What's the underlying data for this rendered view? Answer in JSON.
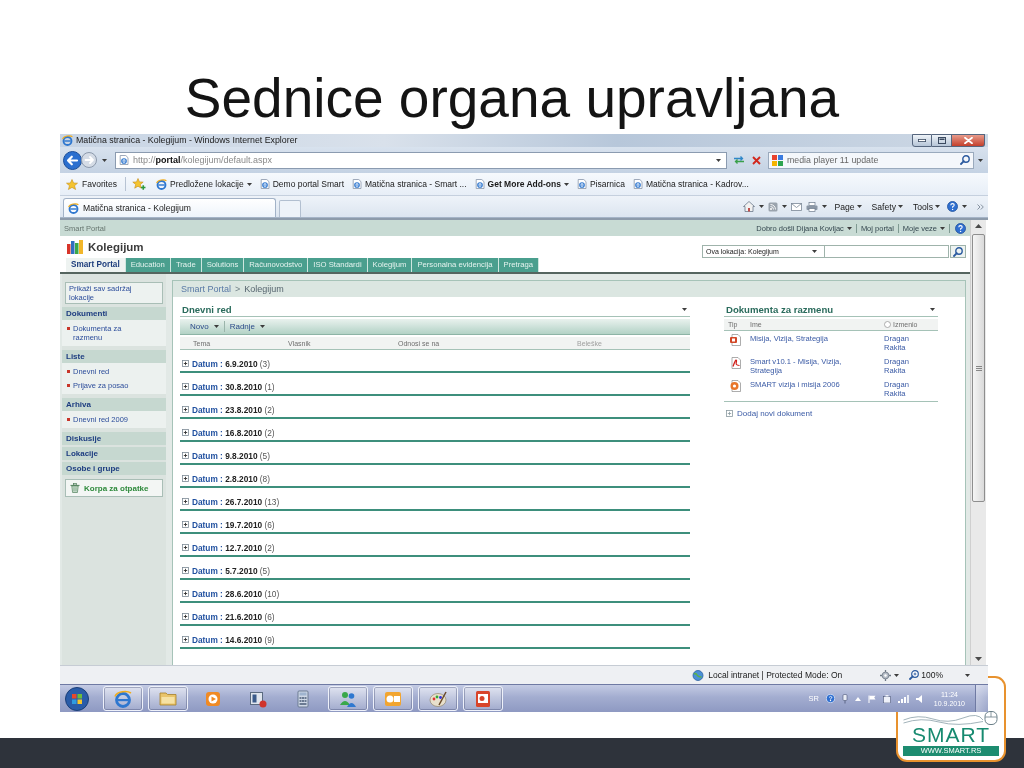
{
  "slide": {
    "title": "Sednice organa upravljana",
    "logo": {
      "wordmark": "SMART",
      "website": "WWW.SMART.RS"
    }
  },
  "browser": {
    "title": "Matična stranica - Kolegijum - Windows Internet Explorer",
    "address": "http://**portal**/kolegijum/default.aspx",
    "search": {
      "value": "media player 11 update"
    },
    "favorites_bar": {
      "label": "Favorites",
      "items": [
        {
          "kind": "suggested",
          "label": "Predložene lokacije",
          "dropdown": true
        },
        {
          "kind": "page",
          "label": "Demo portal Smart",
          "dropdown": false
        },
        {
          "kind": "page",
          "label": "Matična stranica - Smart ...",
          "dropdown": false
        },
        {
          "kind": "addons",
          "label": "Get More Add-ons",
          "dropdown": true
        },
        {
          "kind": "page",
          "label": "Pisarnica",
          "dropdown": false
        },
        {
          "kind": "page",
          "label": "Matična stranica - Kadrov...",
          "dropdown": false
        }
      ]
    },
    "tabs": [
      {
        "label": "Matična stranica - Kolegijum",
        "selected": true
      }
    ],
    "command_bar": {
      "menus": [
        {
          "label": "Page",
          "dropdown": true
        },
        {
          "label": "Safety",
          "dropdown": true
        },
        {
          "label": "Tools",
          "dropdown": true
        }
      ]
    },
    "status_bar": {
      "zone": "Local intranet | Protected Mode: On",
      "zoom": "100%"
    }
  },
  "portal": {
    "top_bar": {
      "site": "Smart Portal",
      "links": [
        {
          "label": "Dobro došli Dijana Kovljac",
          "dropdown": true
        },
        {
          "label": "Moj portal",
          "dropdown": false
        },
        {
          "label": "Moje veze",
          "dropdown": true
        }
      ]
    },
    "site_title": "Kolegijum",
    "tabs": [
      {
        "label": "Smart Portal",
        "selected": true
      },
      {
        "label": "Education",
        "selected": false
      },
      {
        "label": "Trade",
        "selected": false
      },
      {
        "label": "Solutions",
        "selected": false
      },
      {
        "label": "Računovodstvo",
        "selected": false
      },
      {
        "label": "ISO Standardi",
        "selected": false
      },
      {
        "label": "Kolegijum",
        "selected": false
      },
      {
        "label": "Personalna evidencija",
        "selected": false
      },
      {
        "label": "Pretraga",
        "selected": false
      }
    ],
    "search": {
      "scope": "Ova lokacija: Kolegijum"
    },
    "quick_launch": {
      "view_all": "Prikaži sav sadržaj lokacije",
      "sections": [
        {
          "heading": "Dokumenti",
          "items": [
            "Dokumenta za razmenu"
          ]
        },
        {
          "heading": "Liste",
          "items": [
            "Dnevni red",
            "Prijave za posao"
          ]
        },
        {
          "heading": "Arhiva",
          "items": [
            "Dnevni red 2009"
          ]
        },
        {
          "heading": "Diskusije"
        },
        {
          "heading": "Lokacije"
        },
        {
          "heading": "Osobe i grupe"
        }
      ],
      "recycle_bin": "Korpa za otpatke"
    },
    "breadcrumb": {
      "items": [
        "Smart Portal",
        "Kolegijum"
      ],
      "separator": ">"
    },
    "agenda": {
      "title": "Dnevni red",
      "toolbar": [
        {
          "label": "Novo",
          "dropdown": true
        },
        {
          "label": "Radnje",
          "dropdown": true
        }
      ],
      "columns": [
        {
          "label": "Tema",
          "sortable": true
        },
        {
          "label": "Vlasnik",
          "sortable": true
        },
        {
          "label": "Odnosi se na",
          "sortable": true
        },
        {
          "label": "Beleške",
          "sortable": false
        }
      ],
      "groups": [
        {
          "field": "Datum :",
          "date": "6.9.2010",
          "count": "(3)",
          "expanded": false
        },
        {
          "field": "Datum :",
          "date": "30.8.2010",
          "count": "(1)",
          "expanded": false
        },
        {
          "field": "Datum :",
          "date": "23.8.2010",
          "count": "(2)",
          "expanded": false
        },
        {
          "field": "Datum :",
          "date": "16.8.2010",
          "count": "(2)",
          "expanded": false
        },
        {
          "field": "Datum :",
          "date": "9.8.2010",
          "count": "(5)",
          "expanded": false
        },
        {
          "field": "Datum :",
          "date": "2.8.2010",
          "count": "(8)",
          "expanded": false
        },
        {
          "field": "Datum :",
          "date": "26.7.2010",
          "count": "(13)",
          "expanded": false
        },
        {
          "field": "Datum :",
          "date": "19.7.2010",
          "count": "(6)",
          "expanded": false
        },
        {
          "field": "Datum :",
          "date": "12.7.2010",
          "count": "(2)",
          "expanded": false
        },
        {
          "field": "Datum :",
          "date": "5.7.2010",
          "count": "(5)",
          "expanded": false
        },
        {
          "field": "Datum :",
          "date": "28.6.2010",
          "count": "(10)",
          "expanded": false
        },
        {
          "field": "Datum :",
          "date": "21.6.2010",
          "count": "(6)",
          "expanded": false
        },
        {
          "field": "Datum :",
          "date": "14.6.2010",
          "count": "(9)",
          "expanded": false
        }
      ]
    },
    "documents": {
      "title": "Dokumenta za razmenu",
      "columns": [
        {
          "label": "Tip",
          "kind": "text"
        },
        {
          "label": "Ime",
          "kind": "text"
        },
        {
          "label": "Izmenio",
          "kind": "person"
        }
      ],
      "rows": [
        {
          "kind": "pptx",
          "name": "Misija, Vizija, Strategija",
          "modified_by": "Dragan Rakita"
        },
        {
          "kind": "pdf",
          "name": "Smart v10.1 - Misija, Vizija, Strategija",
          "modified_by": "Dragan Rakita"
        },
        {
          "kind": "ppt",
          "name": "SMART vizija i misija 2006",
          "modified_by": "Dragan Rakita"
        }
      ],
      "add_link": "Dodaj novi dokument"
    }
  },
  "taskbar": {
    "apps": [
      {
        "kind": "browser",
        "running": true
      },
      {
        "kind": "folder",
        "running": true
      },
      {
        "kind": "media",
        "running": false
      },
      {
        "kind": "recorder",
        "running": false
      },
      {
        "kind": "calculator",
        "running": false
      },
      {
        "kind": "messenger",
        "running": true
      },
      {
        "kind": "mail",
        "running": true
      },
      {
        "kind": "paint",
        "running": true
      },
      {
        "kind": "presentation",
        "running": true
      }
    ],
    "language": "SR",
    "time": "11:24",
    "date": "10.9.2010"
  }
}
